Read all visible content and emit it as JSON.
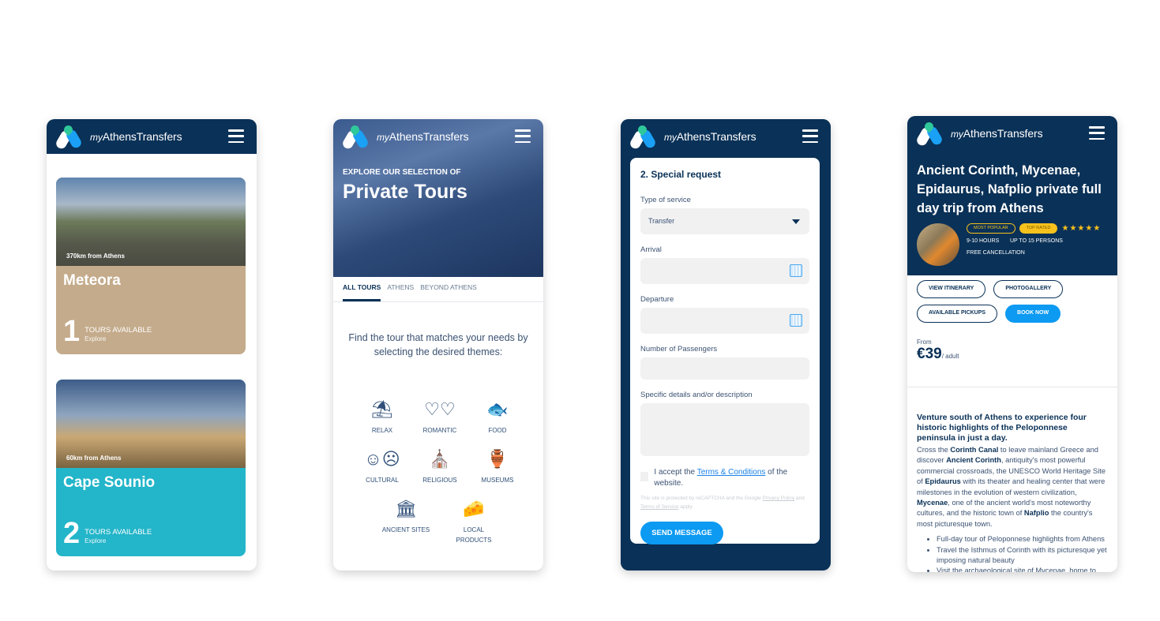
{
  "brand": {
    "prefix": "my",
    "name": "AthensTransfers"
  },
  "colors": {
    "navy": "#0a3157",
    "accent": "#0c9af2",
    "meteora": "#c4ab8b",
    "sounio": "#23b5c9",
    "gold": "#f8c21c"
  },
  "screen1": {
    "destinations": [
      {
        "name": "Meteora",
        "distance": "370km from Athens",
        "count": "1",
        "tours_label": "TOURS AVAILABLE",
        "cta": "Explore"
      },
      {
        "name": "Cape Sounio",
        "distance": "60km from Athens",
        "count": "2",
        "tours_label": "TOURS AVAILABLE",
        "cta": "Explore"
      }
    ]
  },
  "screen2": {
    "subtitle": "EXPLORE OUR SELECTION OF",
    "title": "Private Tours",
    "tabs": [
      {
        "label": "ALL TOURS",
        "active": true
      },
      {
        "label": "ATHENS"
      },
      {
        "label": "BEYOND ATHENS"
      }
    ],
    "intro": "Find the tour that matches your needs by selecting the desired themes:",
    "themes": [
      {
        "label": "RELAX",
        "icon": "beach-umbrella-icon"
      },
      {
        "label": "ROMANTIC",
        "icon": "hearts-icon"
      },
      {
        "label": "FOOD",
        "icon": "fish-icon"
      },
      {
        "label": "CULTURAL",
        "icon": "theater-masks-icon"
      },
      {
        "label": "RELIGIOUS",
        "icon": "church-icon"
      },
      {
        "label": "MUSEUMS",
        "icon": "vase-icon"
      },
      {
        "label": "ANCIENT SITES",
        "icon": "column-icon"
      },
      {
        "label": "LOCAL PRODUCTS",
        "icon": "cheese-oil-icon"
      }
    ]
  },
  "screen3": {
    "heading": "2. Special request",
    "fields": {
      "service_label": "Type of service",
      "service_value": "Transfer",
      "arrival_label": "Arrival",
      "arrival_value": "",
      "departure_label": "Departure",
      "departure_value": "",
      "passengers_label": "Number of Passengers",
      "passengers_value": "",
      "details_label": "Specific details and/or description",
      "details_value": ""
    },
    "terms_pre": "I accept the ",
    "terms_link": "Terms & Conditions",
    "terms_post": " of the website.",
    "recaptcha_pre": "This site is protected by reCAPTCHA and the Google ",
    "privacy_link": "Privacy Policy",
    "recaptcha_mid": " and ",
    "tos_link": "Terms of Service",
    "recaptcha_post": " apply.",
    "send_label": "SEND MESSAGE"
  },
  "screen4": {
    "title": "Ancient Corinth, Mycenae, Epidaurus, Nafplio private full day trip from Athens",
    "badge_popular": "MOST POPULAR",
    "badge_rated": "TOP RATED",
    "rating": 5,
    "stars": "★★★★★",
    "duration": "9-10 HOURS",
    "capacity": "UP TO 15 PERSONS",
    "cancellation": "FREE CANCELLATION",
    "buttons": {
      "itinerary": "VIEW ITINERARY",
      "gallery": "PHOTOGALLERY",
      "pickups": "AVAILABLE PICKUPS",
      "book": "BOOK NOW"
    },
    "price_from": "From",
    "price": "€39",
    "price_unit": "/ adult",
    "lead": "Venture south of Athens to experience four historic highlights of the Peloponnese peninsula in just a day.",
    "body": [
      {
        "t": "Cross the "
      },
      {
        "b": "Corinth Canal"
      },
      {
        "t": " to leave mainland Greece and discover "
      },
      {
        "b": "Ancient Corinth"
      },
      {
        "t": ", antiquity's most powerful commercial crossroads, the UNESCO World Heritage Site of "
      },
      {
        "b": "Epidaurus"
      },
      {
        "t": " with its theater and healing center that were milestones in the evolution of western civilization, "
      },
      {
        "b": "Mycenae"
      },
      {
        "t": ", one of the ancient world's most noteworthy cultures, and the historic town of "
      },
      {
        "b": "Nafplio"
      },
      {
        "t": " the country's most picturesque town."
      }
    ],
    "highlights": [
      "Full-day tour of Peloponnese highlights from Athens",
      "Travel the Isthmus of Corinth with its picturesque yet imposing natural beauty",
      "Visit the archaeological site of Mycenae, home to mythical King Agamemnon"
    ]
  }
}
